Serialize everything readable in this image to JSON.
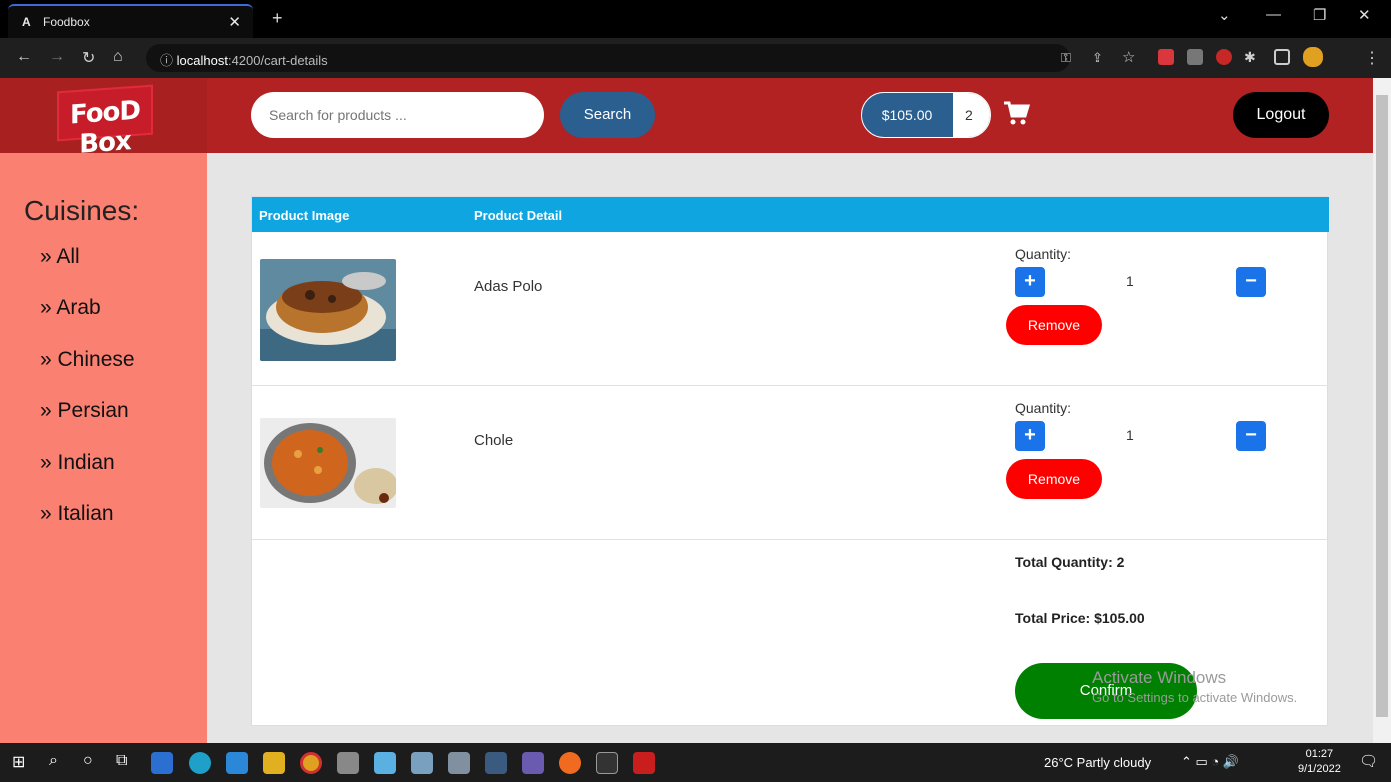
{
  "browser": {
    "tab_title": "Foodbox",
    "tab_favicon": "A",
    "url_host": "localhost",
    "url_rest": ":4200/cart-details"
  },
  "header": {
    "logo_text": "FooD Box",
    "search_placeholder": "Search for products ...",
    "search_button": "Search",
    "cart_total": "$105.00",
    "cart_count": "2",
    "logout_button": "Logout"
  },
  "sidebar": {
    "title": "Cuisines:",
    "items": [
      "» All",
      "» Arab",
      "» Chinese",
      "» Persian",
      "» Indian",
      "» Italian"
    ]
  },
  "cart": {
    "columns": [
      "Product Image",
      "Product Detail"
    ],
    "items": [
      {
        "name": "Adas Polo",
        "quantity_label": "Quantity:",
        "quantity": "1",
        "remove_label": "Remove"
      },
      {
        "name": "Chole",
        "quantity_label": "Quantity:",
        "quantity": "1",
        "remove_label": "Remove"
      }
    ],
    "total_quantity": "Total Quantity: 2",
    "total_price": "Total Price: $105.00",
    "confirm_button": "Confirm"
  },
  "watermark": {
    "line1": "Activate Windows",
    "line2": "Go to Settings to activate Windows."
  },
  "taskbar": {
    "weather": "26°C  Partly cloudy",
    "time": "01:27",
    "date": "9/1/2022"
  },
  "colors": {
    "header": "#b22222",
    "sidebar": "#fa8072",
    "table_header": "#0ea5e0",
    "remove": "#ff0000",
    "confirm": "#008000",
    "qty_button": "#1a73e8"
  }
}
